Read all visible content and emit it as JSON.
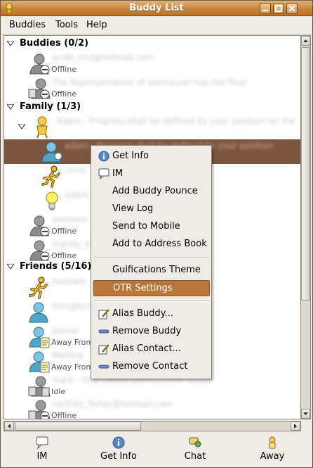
{
  "window": {
    "title": "Buddy List"
  },
  "menubar": [
    {
      "label": "Buddies"
    },
    {
      "label": "Tools"
    },
    {
      "label": "Help"
    }
  ],
  "groups": {
    "buddies": {
      "label": "Buddies (0/2)"
    },
    "family": {
      "label": "Family (1/3)"
    },
    "friends": {
      "label": "Friends (5/16)"
    }
  },
  "buddies": [
    {
      "name": "pcids_tmt@hotmail.com",
      "status": "Offline"
    },
    {
      "name": "The Representative of Vancouver has the floor",
      "status": "Offline"
    },
    {
      "name": "Adam - Progress shall be defined by your position on the",
      "status": ""
    },
    {
      "name": "adam - Progress shall be defined by your position",
      "status": ""
    },
    {
      "name": "chris",
      "status": ""
    },
    {
      "name": "adam",
      "status": ""
    },
    {
      "name": "olenasm",
      "status": "Offline"
    },
    {
      "name": "mandy_b",
      "status": "Offline"
    },
    {
      "name": "fumsam",
      "status": ""
    },
    {
      "name": "kms@bcce",
      "status": ""
    },
    {
      "name": "Daniel",
      "status": "Away From"
    },
    {
      "name": "Waiting",
      "status": "Away From"
    },
    {
      "name": "mark - http://www.ubuntu.com/ sucks",
      "status": "Idle"
    },
    {
      "name": "carlfritz_fisher@hotmail.com",
      "status": "Offline"
    }
  ],
  "context_menu": [
    {
      "label": "Get Info",
      "icon": "info-icon"
    },
    {
      "label": "IM",
      "icon": "im-icon"
    },
    {
      "label": "Add Buddy Pounce",
      "icon": ""
    },
    {
      "label": "View Log",
      "icon": ""
    },
    {
      "label": "Send to Mobile",
      "icon": ""
    },
    {
      "label": "Add to Address Book",
      "icon": ""
    },
    {
      "label": "Guifications Theme",
      "icon": ""
    },
    {
      "label": "OTR Settings",
      "icon": "",
      "highlighted": true
    },
    {
      "label": "Alias Buddy...",
      "icon": "edit-icon"
    },
    {
      "label": "Remove Buddy",
      "icon": "remove-icon"
    },
    {
      "label": "Alias Contact...",
      "icon": "edit-icon"
    },
    {
      "label": "Remove Contact",
      "icon": "remove-icon"
    }
  ],
  "bottom_buttons": [
    {
      "label": "IM",
      "icon": "im-icon"
    },
    {
      "label": "Get Info",
      "icon": "info-icon"
    },
    {
      "label": "Chat",
      "icon": "chat-icon"
    },
    {
      "label": "Away",
      "icon": "away-icon"
    }
  ],
  "colors": {
    "titlebar": "#c8843d",
    "selection": "#7a5540",
    "menu_highlight": "#b8763a"
  }
}
